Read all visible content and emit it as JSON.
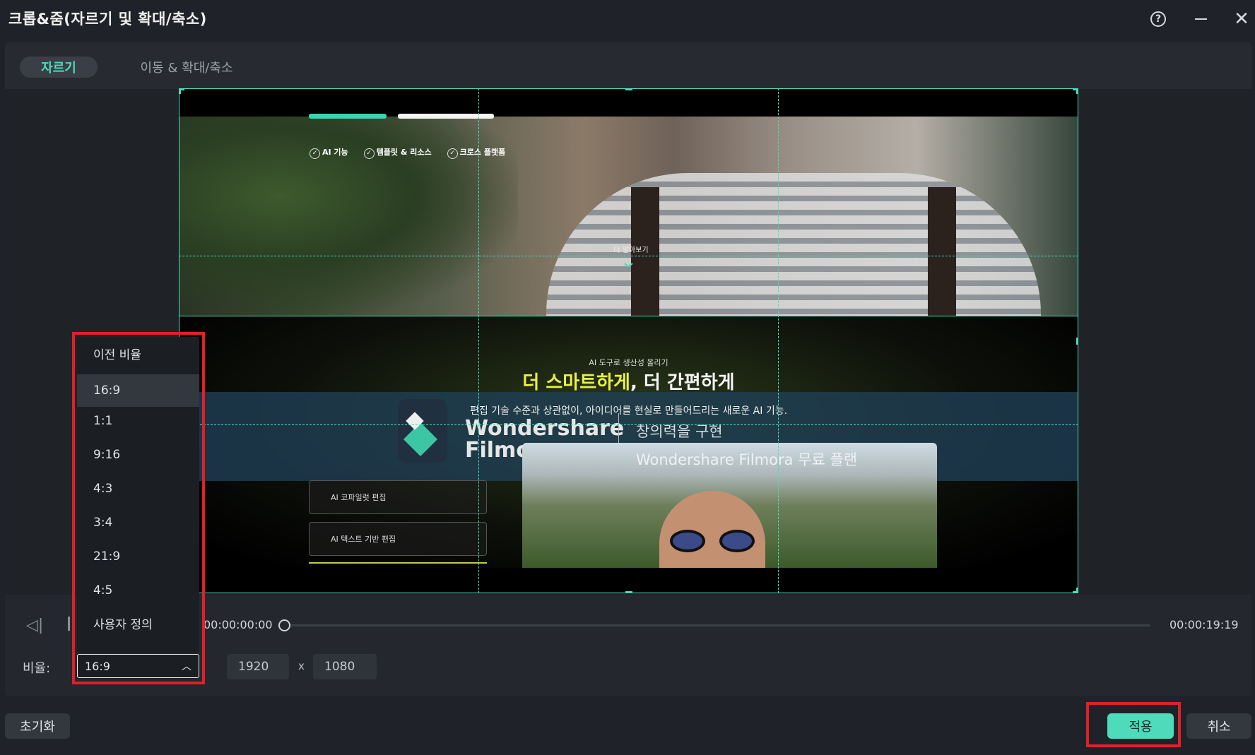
{
  "window": {
    "title": "크롭&줌(자르기 및 확대/축소)",
    "help_icon": "?",
    "minimize_icon": "minimize-icon",
    "close_icon": "✕"
  },
  "tabs": [
    {
      "label": "자르기",
      "active": true
    },
    {
      "label": "이동 & 확대/축소",
      "active": false
    }
  ],
  "preview": {
    "feature_items": [
      "AI 기능",
      "템플릿 & 리소스",
      "크로스 플랫폼"
    ],
    "more_label": "더 알아보기",
    "ai_subtitle": "AI 도구로 생산성 올리기",
    "headline_highlight": "더 스마트하게",
    "headline_rest": ", 더 간편하게",
    "description": "편집 기술 수준과 상관없이, 아이디어를 현실로 만들어드리는 새로운 AI 기능.",
    "brand_line1": "Wondershare",
    "brand_line2": "Filmora",
    "tagline1": "창의력을 구현",
    "tagline2": "Wondershare Filmora 무료 플랜",
    "card1": "AI 코파일럿 편집",
    "card2": "AI 텍스트 기반 편집"
  },
  "playback": {
    "current_time": "00:00:00:00",
    "end_time": "00:00:19:19",
    "progress": 0.0
  },
  "ratio": {
    "label": "비율:",
    "selected": "16:9",
    "options": [
      "이전 비율",
      "16:9",
      "1:1",
      "9:16",
      "4:3",
      "3:4",
      "21:9",
      "4:5",
      "사용자 정의"
    ],
    "width": "1920",
    "separator": "x",
    "height": "1080"
  },
  "buttons": {
    "reset": "초기화",
    "apply": "적용",
    "cancel": "취소"
  },
  "colors": {
    "accent": "#4ddbbb",
    "highlight": "#e0202a",
    "background": "#1f2228"
  }
}
